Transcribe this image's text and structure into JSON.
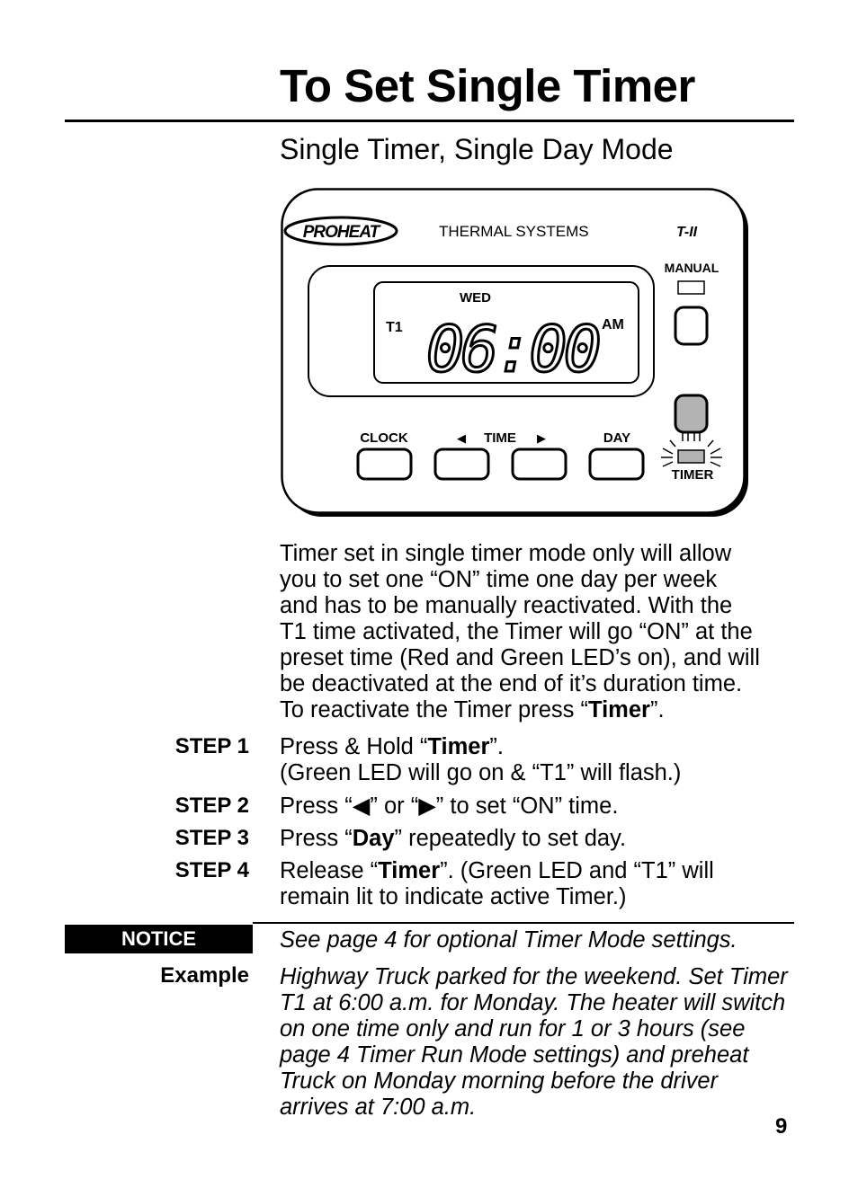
{
  "title": "To Set Single Timer",
  "subtitle": "Single Timer, Single Day Mode",
  "device": {
    "brand": "PROHEAT",
    "brand_tagline": "THERMAL SYSTEMS",
    "model": "T-II",
    "manual_label": "MANUAL",
    "timer_label": "TIMER",
    "display": {
      "day": "WED",
      "program": "T1",
      "time": "06:00",
      "ampm": "AM"
    },
    "buttons": {
      "clock": "CLOCK",
      "time": "TIME",
      "day": "DAY",
      "left_arrow": "◀",
      "right_arrow": "▶"
    },
    "timer_led_color": "#b3b3b3"
  },
  "intro": [
    "Timer set in single timer mode only will allow",
    "you to set one “ON” time one day per week",
    "and has to be manually reactivated. With the",
    "T1 time activated, the Timer will go “ON” at the",
    "preset time (Red and Green LED’s on), and will",
    "be deactivated at the end of it’s duration time."
  ],
  "intro_last": {
    "pre": "To reactivate the Timer press “",
    "bold": "Timer",
    "post": "”."
  },
  "steps": [
    {
      "label": "STEP 1",
      "pre": "Press & Hold “",
      "bold": "Timer",
      "post": "”.",
      "line2": "(Green LED will go on & “T1” will flash.)"
    },
    {
      "label": "STEP 2",
      "pre": "Press “◀” or “▶” to set “ON” time.",
      "bold": "",
      "post": ""
    },
    {
      "label": "STEP 3",
      "pre": "Press “",
      "bold": "Day",
      "post": "” repeatedly to set day."
    },
    {
      "label": "STEP 4",
      "pre": "Release “",
      "bold": "Timer",
      "post": "”. (Green LED and “T1” will",
      "line2": "remain lit to indicate active Timer.)"
    }
  ],
  "notice": {
    "label": "NOTICE",
    "text": "See page 4 for optional Timer Mode settings."
  },
  "example": {
    "label": "Example",
    "lines": [
      "Highway Truck parked for the weekend. Set Timer",
      "T1 at 6:00 a.m. for Monday. The heater will switch",
      "on one time only and run for 1 or 3 hours (see",
      "page 4 Timer Run Mode settings) and preheat",
      "Truck on Monday morning before the driver",
      "arrives at 7:00 a.m."
    ]
  },
  "page_number": "9"
}
